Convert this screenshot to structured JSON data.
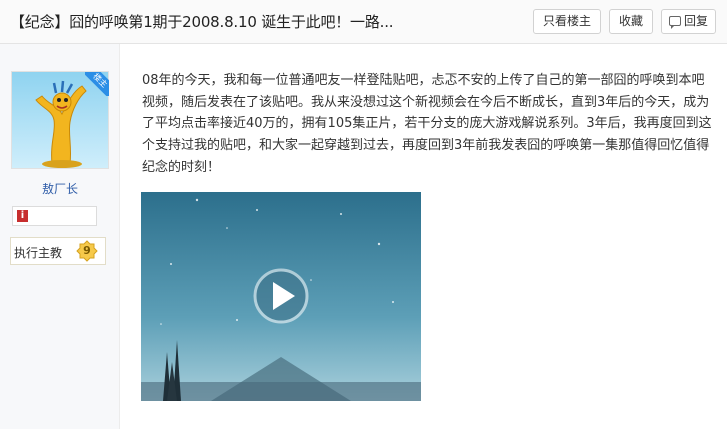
{
  "header": {
    "title": "【纪念】囧的呼唤第1期于2008.8.10 诞生于此吧！一路...",
    "only_louzhu_label": "只看楼主",
    "favorite_label": "收藏",
    "reply_label": "回复"
  },
  "author": {
    "louzhu_badge": "楼主",
    "username": "敖厂长",
    "level_title": "执行主教",
    "level_number": "9"
  },
  "post": {
    "body": "08年的今天，我和每一位普通吧友一样登陆贴吧，忐忑不安的上传了自己的第一部囧的呼唤到本吧视频，随后发表在了该贴吧。我从来没想过这个新视频会在今后不断成长，直到3年后的今天，成为了平均点击率接近40万的，拥有105集正片，若干分支的庞大游戏解说系列。3年后，我再度回到这个支持过我的贴吧，和大家一起穿越到过去，再度回到3年前我发表囧的呼唤第一集那值得回忆值得纪念的时刻！"
  },
  "colors": {
    "accent_blue": "#2b8ee6",
    "username_blue": "#2f5da8",
    "video_sky_top": "#2c6f8c",
    "video_sky_bottom": "#a9d0dc"
  }
}
